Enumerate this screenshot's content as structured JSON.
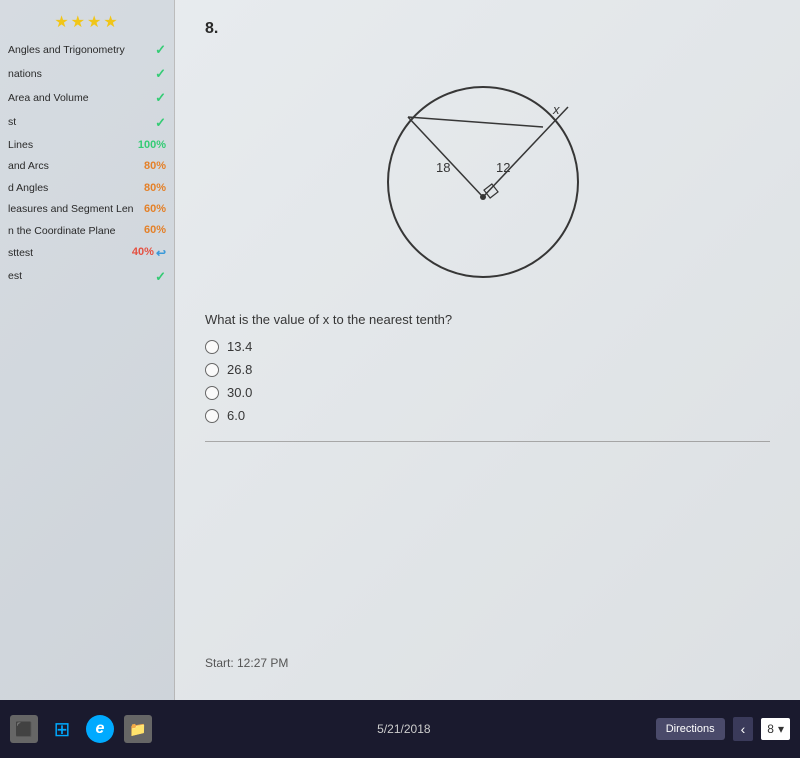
{
  "stars": "★★★★",
  "sidebar": {
    "items": [
      {
        "label": "Angles and Trigonometry",
        "indicator": "check",
        "value": "✓"
      },
      {
        "label": "nations",
        "indicator": "check",
        "value": "✓"
      },
      {
        "label": "Area and Volume",
        "indicator": "check",
        "value": "✓"
      },
      {
        "label": "st",
        "indicator": "check",
        "value": "✓"
      },
      {
        "label": "Lines",
        "indicator": "pct-green",
        "value": "100%"
      },
      {
        "label": "and Arcs",
        "indicator": "pct-orange",
        "value": "80%"
      },
      {
        "label": "d Angles",
        "indicator": "pct-orange",
        "value": "80%"
      },
      {
        "label": "leasures and Segment Len",
        "indicator": "pct-orange",
        "value": "60%"
      },
      {
        "label": "n the Coordinate Plane",
        "indicator": "pct-orange",
        "value": "60%"
      },
      {
        "label": "sttest",
        "indicator": "pct-red",
        "value": "40%"
      },
      {
        "label": "est",
        "indicator": "check",
        "value": "✓"
      }
    ]
  },
  "question": {
    "number": "8.",
    "diagram": {
      "label1": "x",
      "label2": "18",
      "label3": "12"
    },
    "text": "What is the value of x to the nearest tenth?",
    "choices": [
      {
        "value": "13.4"
      },
      {
        "value": "26.8"
      },
      {
        "value": "30.0"
      },
      {
        "value": "6.0"
      }
    ]
  },
  "start_time": "Start: 12:27 PM",
  "taskbar": {
    "date": "5/21/2018",
    "directions_btn": "Directions",
    "page_number": "8"
  }
}
